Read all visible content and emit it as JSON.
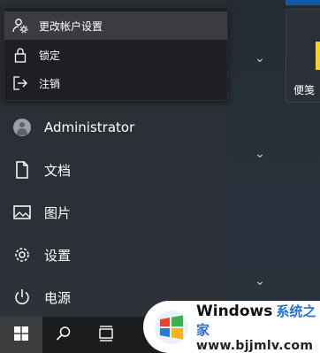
{
  "user_menu": {
    "items": [
      {
        "label": "更改帐户设置",
        "icon": "account-settings-icon",
        "active": true
      },
      {
        "label": "锁定",
        "icon": "lock-icon"
      },
      {
        "label": "注销",
        "icon": "sign-out-icon"
      }
    ]
  },
  "nav": {
    "user": {
      "label": "Administrator",
      "icon": "avatar"
    },
    "documents": {
      "label": "文档",
      "icon": "document-icon"
    },
    "pictures": {
      "label": "图片",
      "icon": "picture-icon"
    },
    "settings": {
      "label": "设置",
      "icon": "gear-icon"
    },
    "power": {
      "label": "电源",
      "icon": "power-icon"
    }
  },
  "tiles": {
    "sticky_notes": {
      "label": "便笺"
    }
  },
  "taskbar": {
    "start_icon": "windows-logo-icon",
    "search_icon": "search-icon",
    "task_view_icon": "task-view-icon"
  },
  "watermark": {
    "title": "Windows",
    "title_cn": "系统之家",
    "url": "www.bjjmlv.com"
  },
  "colors": {
    "accent_blue": "#0f5aa6",
    "sticky_yellow": "#f7d21d",
    "watermark_blue": "#2a6fd6"
  }
}
